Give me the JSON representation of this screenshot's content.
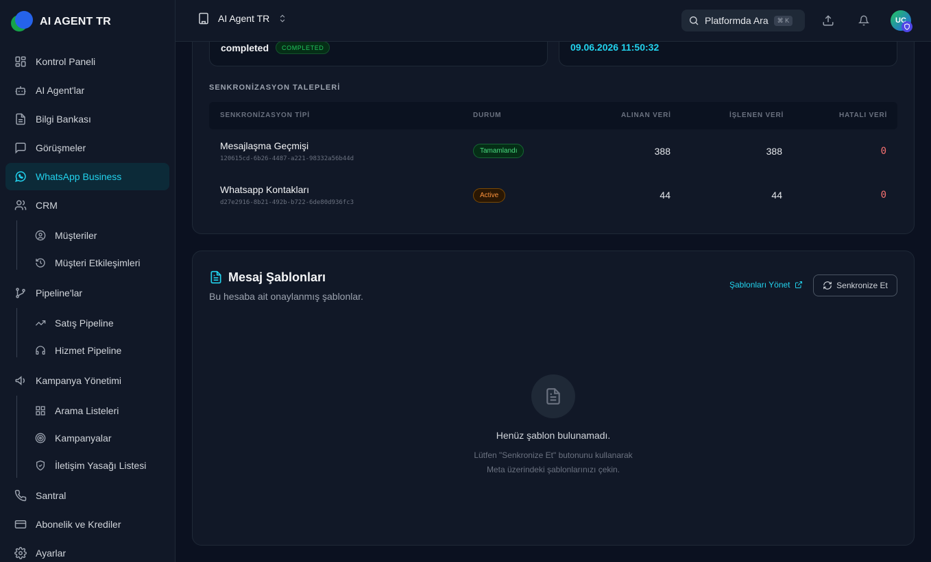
{
  "brand": {
    "name": "AI AGENT TR"
  },
  "sidebar": {
    "items": [
      {
        "label": "Kontrol Paneli",
        "icon": "grid-icon"
      },
      {
        "label": "AI Agent'lar",
        "icon": "bot-icon"
      },
      {
        "label": "Bilgi Bankası",
        "icon": "document-icon"
      },
      {
        "label": "Görüşmeler",
        "icon": "chat-icon"
      },
      {
        "label": "WhatsApp Business",
        "icon": "whatsapp-icon",
        "active": true
      },
      {
        "label": "CRM",
        "icon": "users-icon"
      },
      {
        "label": "Müşteriler",
        "icon": "user-circle-icon"
      },
      {
        "label": "Müşteri Etkileşimleri",
        "icon": "history-icon"
      },
      {
        "label": "Pipeline'lar",
        "icon": "git-branch-icon"
      },
      {
        "label": "Satış Pipeline",
        "icon": "trend-icon"
      },
      {
        "label": "Hizmet Pipeline",
        "icon": "headset-icon"
      },
      {
        "label": "Kampanya Yönetimi",
        "icon": "megaphone-icon"
      },
      {
        "label": "Arama Listeleri",
        "icon": "grid-icon"
      },
      {
        "label": "Kampanyalar",
        "icon": "target-icon"
      },
      {
        "label": "İletişim Yasağı Listesi",
        "icon": "shield-icon"
      },
      {
        "label": "Santral",
        "icon": "phone-icon"
      },
      {
        "label": "Abonelik ve Krediler",
        "icon": "credit-card-icon"
      },
      {
        "label": "Ayarlar",
        "icon": "gear-icon"
      }
    ]
  },
  "header": {
    "workspace": "AI Agent TR",
    "search_label": "Platformda Ara",
    "search_shortcut": "⌘ K",
    "avatar_initials": "UC"
  },
  "sync_summary": {
    "status_text": "completed",
    "status_badge": "COMPLETED",
    "date": "09.06.2026 11:50:32"
  },
  "sync_requests": {
    "title": "SENKRONİZASYON TALEPLERİ",
    "columns": [
      "SENKRONİZASYON TİPİ",
      "DURUM",
      "ALINAN VERİ",
      "İŞLENEN VERİ",
      "HATALI VERİ"
    ],
    "rows": [
      {
        "type": "Mesajlaşma Geçmişi",
        "id": "120615cd-6b26-4487-a221-98332a56b44d",
        "status": "Tamamlandı",
        "received": "388",
        "processed": "388",
        "errors": "0"
      },
      {
        "type": "Whatsapp Kontakları",
        "id": "d27e2916-8b21-492b-b722-6de80d936fc3",
        "status": "Active",
        "received": "44",
        "processed": "44",
        "errors": "0"
      }
    ]
  },
  "templates": {
    "title": "Mesaj Şablonları",
    "subtitle": "Bu hesaba ait onaylanmış şablonlar.",
    "manage_link": "Şablonları Yönet",
    "sync_button": "Senkronize Et",
    "empty_title": "Henüz şablon bulunamadı.",
    "empty_line1": "Lütfen \"Senkronize Et\" butonunu kullanarak",
    "empty_line2": "Meta üzerindeki şablonlarınızı çekin."
  },
  "colors": {
    "accent": "#22d3ee",
    "success": "#22c55e",
    "warning": "#fb923c",
    "danger": "#f87171"
  }
}
